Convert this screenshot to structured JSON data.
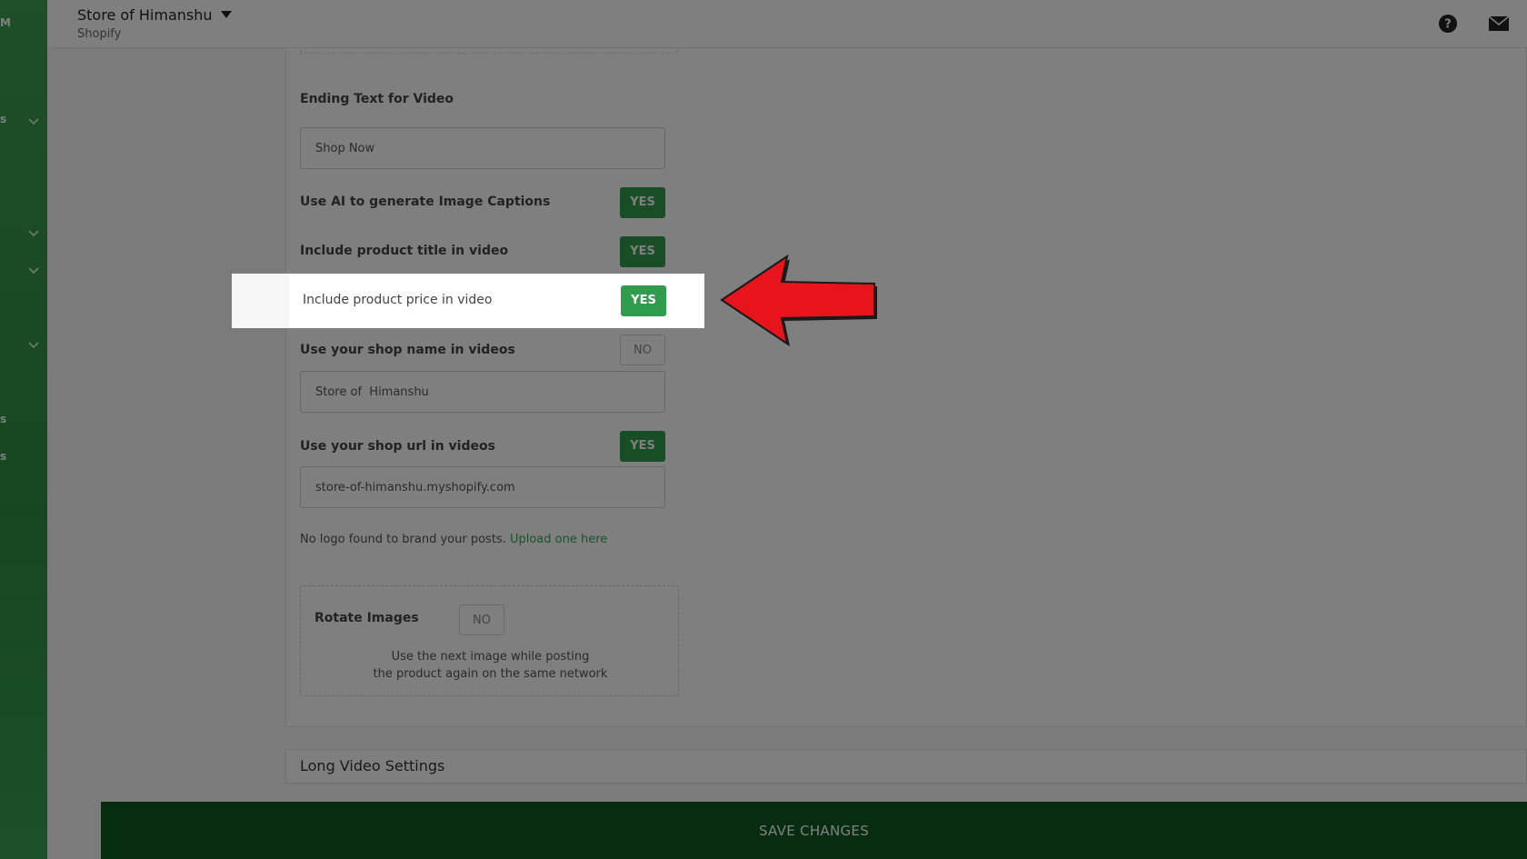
{
  "header": {
    "store_name": "Store of Himanshu",
    "platform": "Shopify"
  },
  "icons": {
    "help": "help-circle-icon",
    "mail": "mail-icon",
    "caret": "caret-down-icon",
    "chevron": "chevron-down-icon",
    "arrow": "red-arrow-pointer-icon"
  },
  "colors": {
    "sidebar": "#3c9e4e",
    "yes_toggle": "#2f9d4d",
    "save_bar": "#0e5a23",
    "link": "#3aa35a",
    "arrow": "#e8141c"
  },
  "sidebar": {
    "fragments": [
      "M",
      "s",
      "s",
      "s"
    ]
  },
  "form": {
    "ending_text_label": "Ending Text for Video",
    "ending_text_value": "Shop Now",
    "ai_captions": {
      "label": "Use AI to generate Image Captions",
      "value": "YES"
    },
    "product_title": {
      "label": "Include product title in video",
      "value": "YES"
    },
    "product_price": {
      "label": "Include product price in video",
      "value": "YES"
    },
    "shop_name": {
      "label": "Use your shop name in videos",
      "value": "NO",
      "input_value": "Store of  Himanshu"
    },
    "shop_url": {
      "label": "Use your shop url in videos",
      "value": "YES",
      "input_value": "store-of-himanshu.myshopify.com"
    },
    "logo_note": "No logo found to brand your posts.",
    "logo_link": "Upload one here",
    "rotate": {
      "label": "Rotate Images",
      "value": "NO",
      "desc_line1": "Use the next image while posting",
      "desc_line2": "the product again on the same network"
    }
  },
  "long_video": {
    "title": "Long Video Settings"
  },
  "save": {
    "label": "SAVE CHANGES"
  }
}
